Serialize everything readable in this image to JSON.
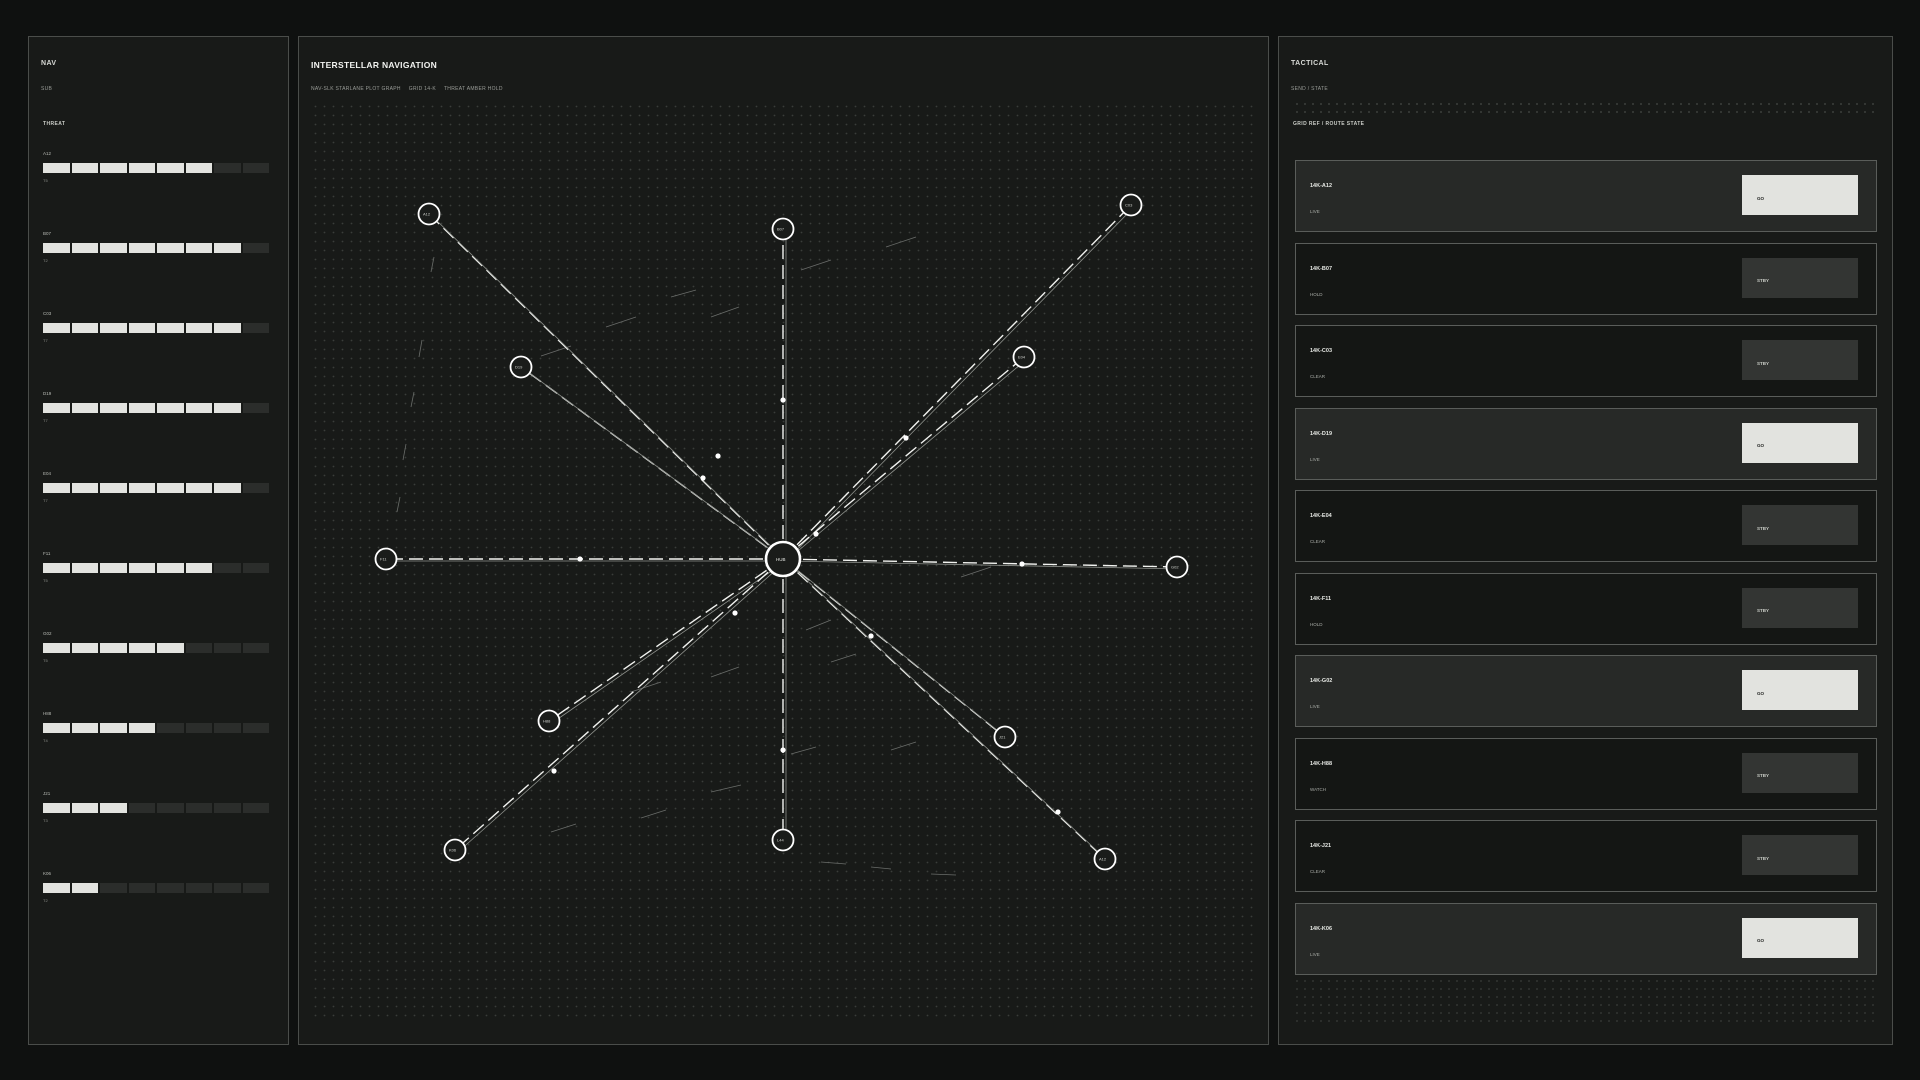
{
  "nav": {
    "title": "NAV",
    "subtitle": "SUB",
    "section_label": "THREAT",
    "threats": [
      {
        "code": "A12",
        "level": 6,
        "value": "T5"
      },
      {
        "code": "B07",
        "level": 7,
        "value": "T2"
      },
      {
        "code": "C03",
        "level": 7,
        "value": "T7"
      },
      {
        "code": "D19",
        "level": 7,
        "value": "T7"
      },
      {
        "code": "E04",
        "level": 7,
        "value": "T7"
      },
      {
        "code": "F11",
        "level": 6,
        "value": "T5"
      },
      {
        "code": "G02",
        "level": 5,
        "value": "T5"
      },
      {
        "code": "H88",
        "level": 4,
        "value": "T4"
      },
      {
        "code": "J21",
        "level": 3,
        "value": "T3"
      },
      {
        "code": "K06",
        "level": 2,
        "value": "T2"
      }
    ],
    "segments_total": 8
  },
  "map": {
    "title": "INTERSTELLAR NAVIGATION",
    "subtitle_parts": [
      "NAV-SLK STARLANE PLOT GRAPH",
      "GRID 14-K",
      "THREAT AMBER HOLD"
    ],
    "hub_label": "HUB",
    "nodes": [
      "A12",
      "B07",
      "C03",
      "D19",
      "E04",
      "F11",
      "G02",
      "H88",
      "J21",
      "K06",
      "L44"
    ]
  },
  "tactical": {
    "title": "TACTICAL",
    "subtitle": "SEND / STATE",
    "section_label": "GRID REF / ROUTE STATE",
    "routes": [
      {
        "id": "14K-A12",
        "state": "LIVE",
        "action": "GO",
        "live": true
      },
      {
        "id": "14K-B07",
        "state": "HOLD",
        "action": "STBY",
        "live": false
      },
      {
        "id": "14K-C03",
        "state": "CLEAR",
        "action": "STBY",
        "live": false
      },
      {
        "id": "14K-D19",
        "state": "LIVE",
        "action": "GO",
        "live": true
      },
      {
        "id": "14K-E04",
        "state": "CLEAR",
        "action": "STBY",
        "live": false
      },
      {
        "id": "14K-F11",
        "state": "HOLD",
        "action": "STBY",
        "live": false
      },
      {
        "id": "14K-G02",
        "state": "LIVE",
        "action": "GO",
        "live": true
      },
      {
        "id": "14K-H88",
        "state": "WATCH",
        "action": "STBY",
        "live": false
      },
      {
        "id": "14K-J21",
        "state": "CLEAR",
        "action": "STBY",
        "live": false
      },
      {
        "id": "14K-K06",
        "state": "LIVE",
        "action": "GO",
        "live": true
      }
    ]
  },
  "colors": {
    "background": "#0f1110",
    "panel": "#181a18",
    "accent": "#e2e3df",
    "line": "#ffffff"
  }
}
